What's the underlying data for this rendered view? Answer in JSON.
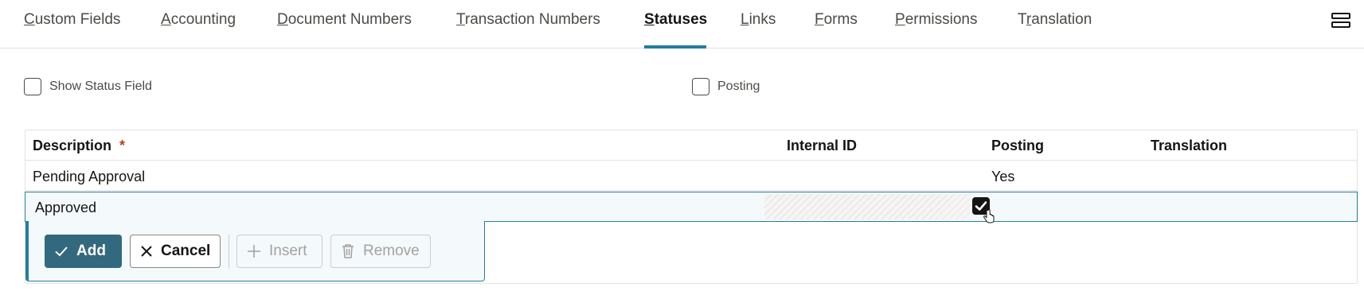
{
  "tabs": [
    {
      "label": "Custom Fields",
      "access_key": "C",
      "rest": "ustom Fields",
      "active": false
    },
    {
      "label": "Accounting",
      "access_key": "A",
      "rest": "ccounting",
      "active": false
    },
    {
      "label": "Document Numbers",
      "access_key": "D",
      "rest": "ocument Numbers",
      "active": false
    },
    {
      "label": "Transaction Numbers",
      "access_key": "T",
      "rest": "ransaction Numbers",
      "active": false
    },
    {
      "label": "Statuses",
      "access_key": "S",
      "rest": "tatuses",
      "active": true
    },
    {
      "label": "Links",
      "access_key": "L",
      "rest": "inks",
      "active": false
    },
    {
      "label": "Forms",
      "access_key": "F",
      "rest": "orms",
      "active": false
    },
    {
      "label": "Permissions",
      "access_key": "P",
      "rest": "ermissions",
      "active": false
    },
    {
      "label": "Translation",
      "access_key": "r",
      "pre": "T",
      "rest": "anslation",
      "active": false
    }
  ],
  "options": {
    "show_status_field": {
      "label": "Show Status Field",
      "checked": false
    },
    "posting": {
      "label": "Posting",
      "checked": false
    }
  },
  "grid": {
    "columns": {
      "description": "Description",
      "required_mark": "*",
      "internal_id": "Internal ID",
      "posting": "Posting",
      "translation": "Translation"
    },
    "rows": [
      {
        "description": "Pending Approval",
        "internal_id": "",
        "posting": "Yes",
        "translation": ""
      }
    ],
    "edit_row": {
      "description": "Approved",
      "posting_checked": true
    },
    "actions": {
      "add": "Add",
      "cancel": "Cancel",
      "insert": "Insert",
      "remove": "Remove"
    }
  },
  "colors": {
    "accent": "#227e9e",
    "primary_button": "#33697e",
    "required": "#b6401f"
  }
}
